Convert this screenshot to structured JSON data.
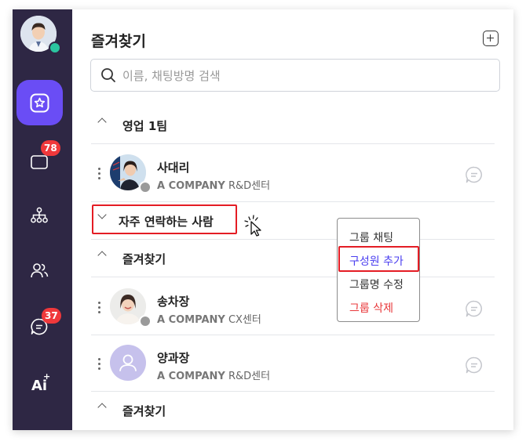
{
  "sidebar": {
    "badges": {
      "chat_rooms": "78",
      "messages": "37"
    },
    "ai_label": "Ai",
    "colors": {
      "background": "#2e2744",
      "active": "#6a4df5",
      "badge": "#f0383b",
      "online": "#2bc5a0"
    }
  },
  "header": {
    "title": "즐겨찾기"
  },
  "search": {
    "placeholder": "이름, 채팅방명 검색",
    "value": ""
  },
  "groups": [
    {
      "label": "영업 1팀",
      "expanded": true,
      "contacts": [
        {
          "name": "사대리",
          "company": "A COMPANY",
          "dept": "R&D센터",
          "avatar": "photo-woman-presenting"
        }
      ]
    },
    {
      "label": "자주 연락하는 사람",
      "expanded": false,
      "contacts": []
    },
    {
      "label": "즐겨찾기",
      "expanded": true,
      "contacts": [
        {
          "name": "송차장",
          "company": "A COMPANY",
          "dept": "CX센터",
          "avatar": "photo-woman-smiling"
        },
        {
          "name": "양과장",
          "company": "A COMPANY",
          "dept": "R&D센터",
          "avatar": "default-person-icon"
        }
      ]
    },
    {
      "label": "즐겨찾기",
      "expanded": true,
      "contacts": []
    }
  ],
  "context_menu": {
    "items": [
      {
        "label": "그룹 채팅",
        "style": "normal"
      },
      {
        "label": "구성원 추가",
        "style": "primary"
      },
      {
        "label": "그룹명 수정",
        "style": "normal"
      },
      {
        "label": "그룹 삭제",
        "style": "danger"
      }
    ]
  }
}
